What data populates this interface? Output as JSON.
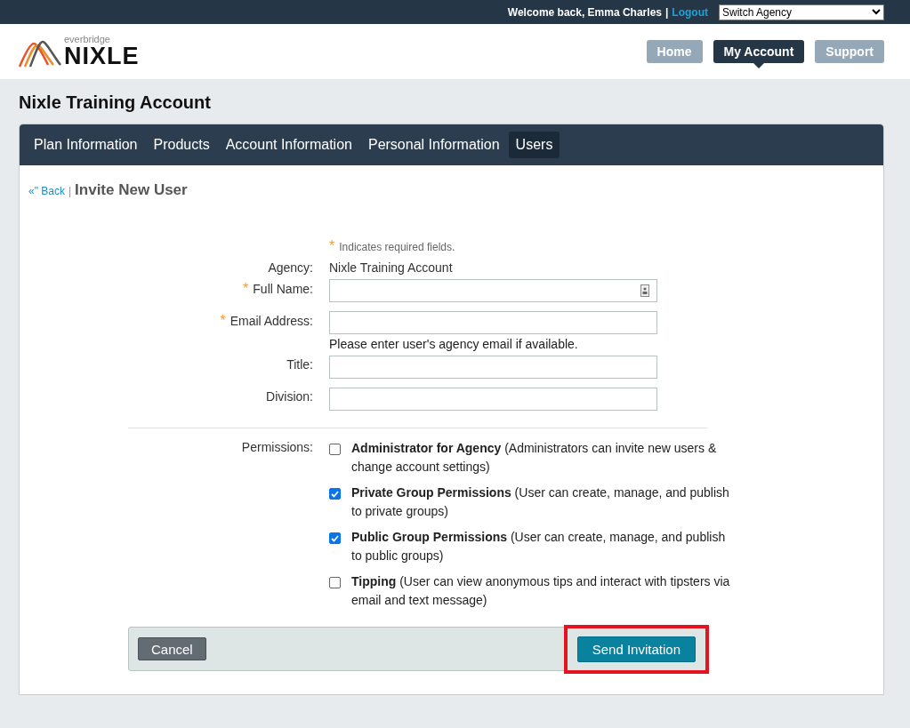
{
  "top_bar": {
    "welcome": "Welcome back, Emma Charles",
    "separator": "|",
    "logout": "Logout",
    "agency_select": "Switch Agency"
  },
  "logo": {
    "small": "everbridge",
    "big": "NIXLE"
  },
  "header_nav": [
    {
      "label": "Home",
      "selected": false
    },
    {
      "label": "My Account",
      "selected": true
    },
    {
      "label": "Support",
      "selected": false
    }
  ],
  "page_title": "Nixle Training Account",
  "tabs": [
    {
      "label": "Plan Information",
      "selected": false
    },
    {
      "label": "Products",
      "selected": false
    },
    {
      "label": "Account Information",
      "selected": false
    },
    {
      "label": "Personal Information",
      "selected": false
    },
    {
      "label": "Users",
      "selected": true
    }
  ],
  "breadcrumb": {
    "back": "«\" Back",
    "separator": "|",
    "title": "Invite New User"
  },
  "form": {
    "required_note_star": "*",
    "required_note": "Indicates required fields.",
    "rows": [
      {
        "kind": "static",
        "label": "Agency:",
        "required": false,
        "value": "Nixle Training Account"
      },
      {
        "kind": "input",
        "label": "Full Name:",
        "required": true,
        "contact_icon": true
      },
      {
        "kind": "input",
        "label": "Email Address:",
        "required": true,
        "hint": "Please enter user's agency email if available."
      },
      {
        "kind": "input",
        "label": "Title:",
        "required": false
      },
      {
        "kind": "input",
        "label": "Division:",
        "required": false
      }
    ],
    "permissions_label": "Permissions:",
    "permissions": [
      {
        "text": "**Administrator for Agency** (Administrators can invite new users & change account settings)",
        "checked": false
      },
      {
        "text": "**Private Group Permissions** (User can create, manage, and publish to private groups)",
        "checked": true
      },
      {
        "text": "**Public Group Permissions** (User can create, manage, and publish to public groups)",
        "checked": true
      },
      {
        "text": "**Tipping** (User can view anonymous tips and interact with tipsters via email and text message)",
        "checked": false
      }
    ]
  },
  "footer": {
    "cancel": "Cancel",
    "submit": "Send Invitation",
    "submit_highlighted": true
  }
}
